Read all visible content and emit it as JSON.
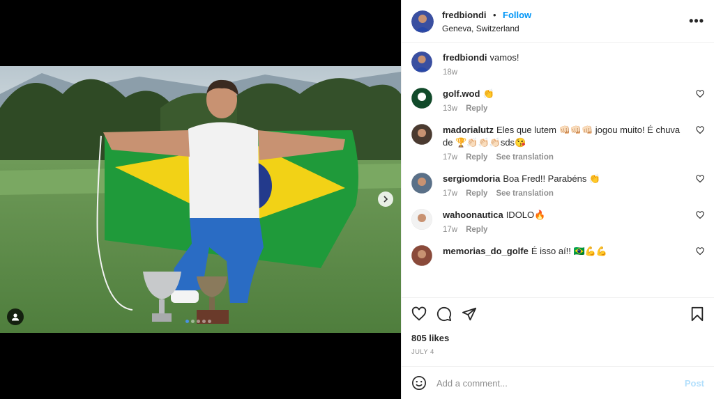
{
  "post": {
    "author": "fredbiondi",
    "follow_label": "Follow",
    "separator": "•",
    "location": "Geneva, Switzerland",
    "more_label": "•••"
  },
  "caption": {
    "user": "fredbiondi",
    "text": "vamos!",
    "time": "18w"
  },
  "comments": [
    {
      "user": "golf.wod",
      "text": "👏",
      "time": "13w",
      "reply": "Reply",
      "translate": ""
    },
    {
      "user": "madorialutz",
      "text": "Eles que lutem 👊🏻👊🏻👊🏻 jogou muito! É chuva de 🏆👏🏻👏🏻👏🏻sds😘",
      "time": "17w",
      "reply": "Reply",
      "translate": "See translation"
    },
    {
      "user": "sergiomdoria",
      "text": "Boa Fred!! Parabéns 👏",
      "time": "17w",
      "reply": "Reply",
      "translate": "See translation"
    },
    {
      "user": "wahoonautica",
      "text": "IDOLO🔥",
      "time": "17w",
      "reply": "Reply",
      "translate": ""
    },
    {
      "user": "memorias_do_golfe",
      "text": "É isso aí!! 🇧🇷💪💪",
      "time": "",
      "reply": "",
      "translate": ""
    }
  ],
  "likes": "805 likes",
  "date": "JULY 4",
  "add_comment": {
    "placeholder": "Add a comment...",
    "post_label": "Post"
  },
  "carousel": {
    "slide_count": 5,
    "active_index": 0
  },
  "colors": {
    "follow": "#0095f6",
    "post_disabled": "#b2dffc",
    "muted": "#8e8e8e",
    "text": "#262626"
  }
}
